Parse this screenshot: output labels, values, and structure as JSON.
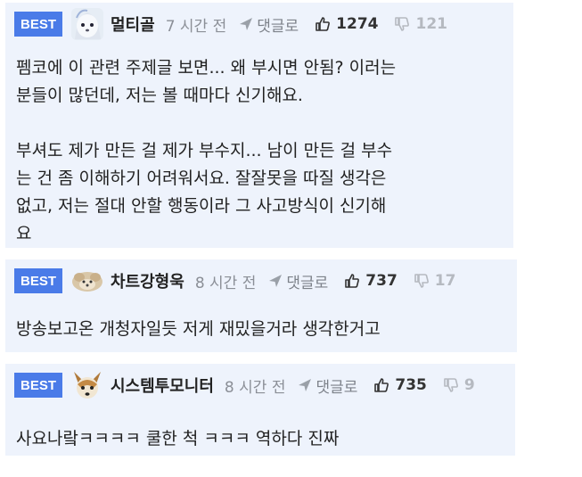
{
  "comments": [
    {
      "badge": "BEST",
      "nickname": "멀티골",
      "time": "7 시간 전",
      "reply_label": "댓글로",
      "likes": "1274",
      "dislikes": "121",
      "text": "펨코에 이 관련 주제글 보면... 왜 부시면 안됨? 이러는\n분들이 많던데, 저는 볼 때마다 신기해요.\n\n부셔도 제가 만든 걸 제가 부수지... 남이 만든 걸 부수\n는 건 좀 이해하기 어려워서요. 잘잘못을 따질 생각은\n없고, 저는 절대 안할 행동이라 그 사고방식이 신기해\n요"
    },
    {
      "badge": "BEST",
      "nickname": "차트강형욱",
      "time": "8 시간 전",
      "reply_label": "댓글로",
      "likes": "737",
      "dislikes": "17",
      "text": "방송보고온 개청자일듯 저게 재밌을거라 생각한거고"
    },
    {
      "badge": "BEST",
      "nickname": "시스템투모니터",
      "time": "8 시간 전",
      "reply_label": "댓글로",
      "likes": "735",
      "dislikes": "9",
      "text": "사요나랔ㅋㅋㅋㅋ 쿨한 척 ㅋㅋㅋ 역하다 진짜"
    }
  ],
  "colors": {
    "badge": "#4a7be8",
    "card_bg": "#eef3fc",
    "muted": "#8b8f97"
  }
}
